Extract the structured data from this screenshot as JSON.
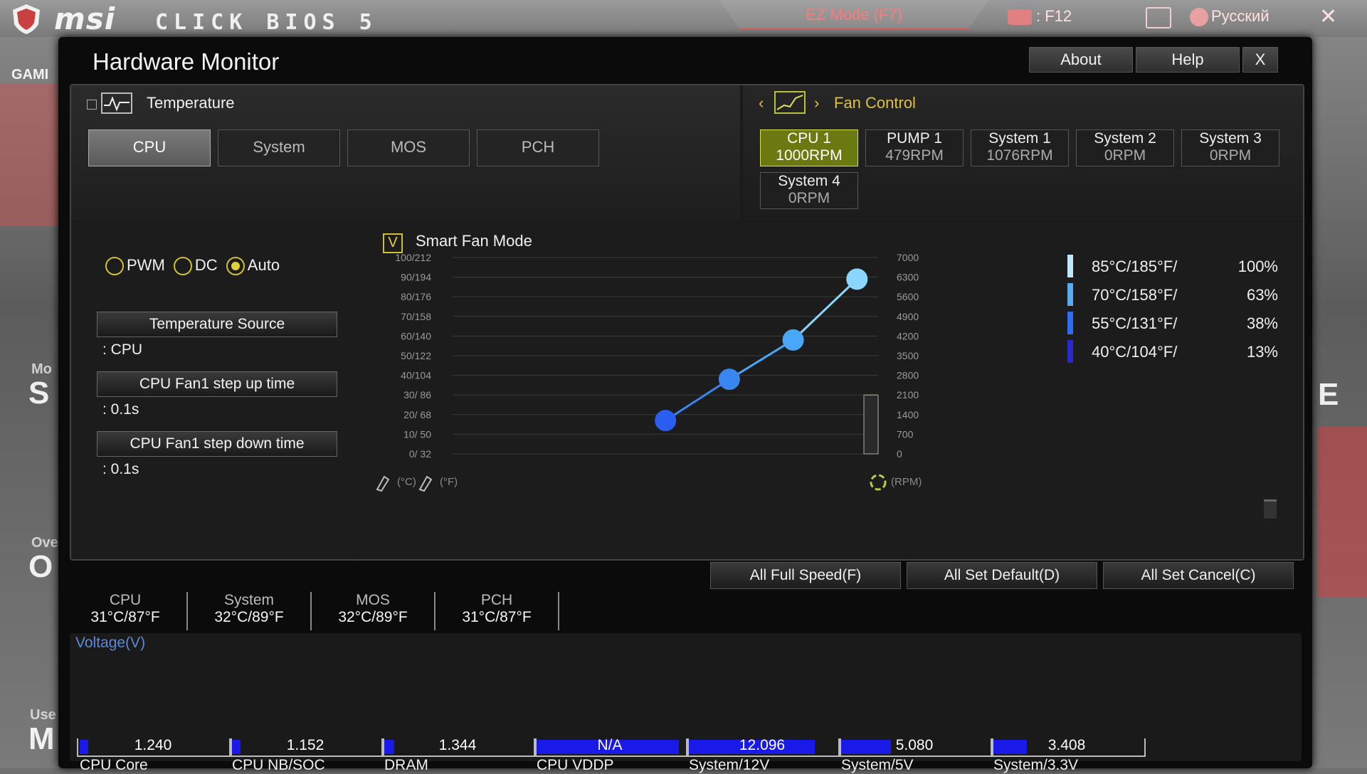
{
  "top": {
    "brand": "msi",
    "bios_name": "CLICK BIOS 5",
    "ez_mode": "EZ Mode (F7)",
    "screenshot_key": ": F12",
    "language": "Русский",
    "close_glyph": "✕"
  },
  "background_fragments": {
    "game": "GAMI",
    "mo": "Mo",
    "s": "S",
    "ov": "Ove",
    "o": "O",
    "use": "Use",
    "m": "M",
    "e": "E"
  },
  "window": {
    "title": "Hardware Monitor",
    "about": "About",
    "help": "Help",
    "close": "X"
  },
  "temperature": {
    "label": "Temperature",
    "tabs": [
      "CPU",
      "System",
      "MOS",
      "PCH"
    ],
    "active_tab": "CPU"
  },
  "fan_control": {
    "label": "Fan Control",
    "fans": [
      {
        "name": "CPU 1",
        "rpm": "1000RPM",
        "active": true
      },
      {
        "name": "PUMP 1",
        "rpm": "479RPM"
      },
      {
        "name": "System 1",
        "rpm": "1076RPM"
      },
      {
        "name": "System 2",
        "rpm": "0RPM"
      },
      {
        "name": "System 3",
        "rpm": "0RPM"
      },
      {
        "name": "System 4",
        "rpm": "0RPM"
      }
    ]
  },
  "mode": {
    "pwm": "PWM",
    "dc": "DC",
    "auto": "Auto",
    "selected": "Auto"
  },
  "options": {
    "temp_source_label": "Temperature Source",
    "temp_source_value": ": CPU",
    "step_up_label": "CPU Fan1 step up time",
    "step_up_value": ": 0.1s",
    "step_down_label": "CPU Fan1 step down time",
    "step_down_value": ": 0.1s"
  },
  "smart_fan": {
    "label": "Smart Fan Mode",
    "checked": true,
    "check_glyph": "V",
    "celsius_unit": "(°C)",
    "fahrenheit_unit": "(°F)",
    "rpm_unit": "(RPM)"
  },
  "chart_data": {
    "type": "line",
    "title": "",
    "y_left_ticks": [
      "100/212",
      "90/194",
      "80/176",
      "70/158",
      "60/140",
      "50/122",
      "40/104",
      "30/ 86",
      "20/ 68",
      "10/ 50",
      "0/ 32"
    ],
    "y_right_ticks": [
      "7000",
      "6300",
      "5600",
      "4900",
      "4200",
      "3500",
      "2800",
      "2100",
      "1400",
      "700",
      "0"
    ],
    "ylim": [
      0,
      100
    ],
    "series": [
      {
        "points": [
          {
            "temp_c": 40,
            "fan_pct": 17
          },
          {
            "temp_c": 55,
            "fan_pct": 38
          },
          {
            "temp_c": 70,
            "fan_pct": 58
          },
          {
            "temp_c": 85,
            "fan_pct": 89
          }
        ]
      }
    ],
    "current_rpm_level": 1000,
    "point_colors": [
      "#2a5ef0",
      "#3a86f0",
      "#4aa6f6",
      "#8ad6ff"
    ]
  },
  "legend": [
    {
      "temp": "85°C/185°F/",
      "pct": "100%",
      "color": "#bfe8ff"
    },
    {
      "temp": "70°C/158°F/",
      "pct": "63%",
      "color": "#5aaaf0"
    },
    {
      "temp": "55°C/131°F/",
      "pct": "38%",
      "color": "#2f6ef0"
    },
    {
      "temp": "40°C/104°F/",
      "pct": "13%",
      "color": "#2a2ac8"
    }
  ],
  "actions": {
    "full_speed": "All Full Speed(F)",
    "set_default": "All Set Default(D)",
    "set_cancel": "All Set Cancel(C)"
  },
  "temp_summary": [
    {
      "name": "CPU",
      "value": "31°C/87°F"
    },
    {
      "name": "System",
      "value": "32°C/89°F"
    },
    {
      "name": "MOS",
      "value": "32°C/89°F"
    },
    {
      "name": "PCH",
      "value": "31°C/87°F"
    }
  ],
  "voltage": {
    "title": "Voltage(V)",
    "meters": [
      {
        "name": "CPU Core",
        "value": "1.240",
        "fill_fraction": 0.06
      },
      {
        "name": "CPU NB/SOC",
        "value": "1.152",
        "fill_fraction": 0.06
      },
      {
        "name": "DRAM",
        "value": "1.344",
        "fill_fraction": 0.07
      },
      {
        "name": "CPU VDDP",
        "value": "N/A",
        "fill_fraction": 0.97
      },
      {
        "name": "System/12V",
        "value": "12.096",
        "fill_fraction": 0.86
      },
      {
        "name": "System/5V",
        "value": "5.080",
        "fill_fraction": 0.34
      },
      {
        "name": "System/3.3V",
        "value": "3.408",
        "fill_fraction": 0.23
      }
    ]
  },
  "colors": {
    "accent_yellow": "#e0c040",
    "active_fan": "#6a7a10",
    "voltage_fill": "#1a1ae8",
    "voltage_title": "#5a8ad8"
  }
}
